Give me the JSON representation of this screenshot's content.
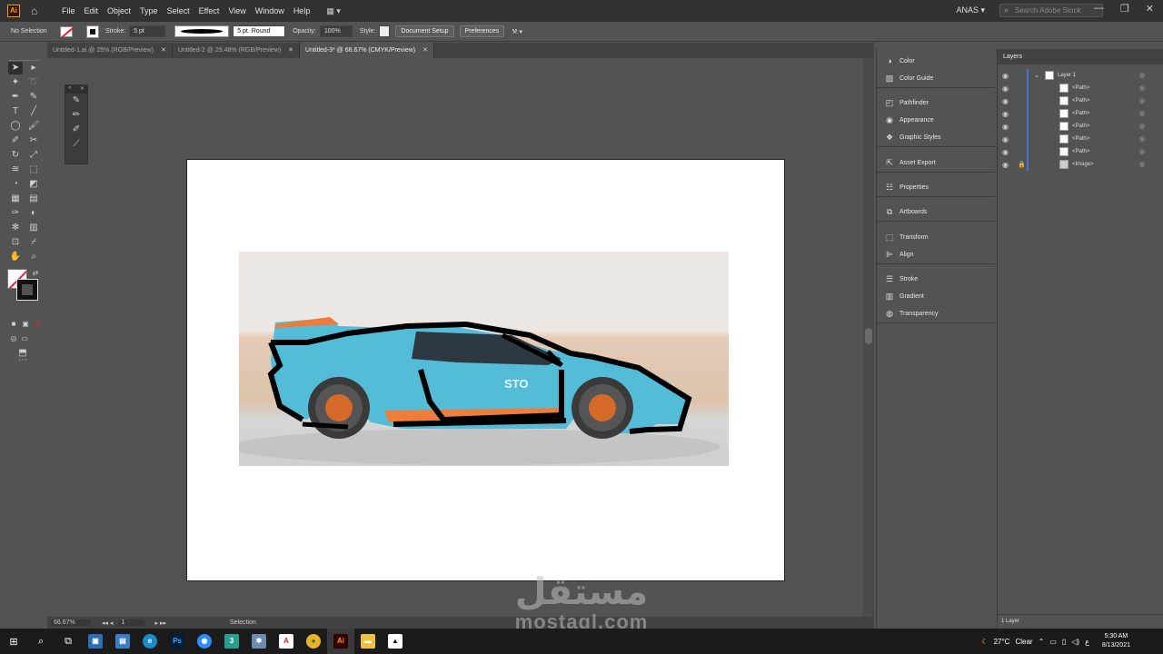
{
  "app": {
    "logo": "Ai",
    "user": "ANAS",
    "search_placeholder": "Search Adobe Stock"
  },
  "menu": [
    "File",
    "Edit",
    "Object",
    "Type",
    "Select",
    "Effect",
    "View",
    "Window",
    "Help"
  ],
  "control": {
    "selection": "No Selection",
    "stroke_label": "Stroke:",
    "stroke_value": "5 pt",
    "brush_label": "5 pt. Round",
    "opacity_label": "Opacity:",
    "opacity_value": "100%",
    "style_label": "Style:",
    "doc_setup": "Document Setup",
    "preferences": "Preferences"
  },
  "tabs": [
    {
      "label": "Untitled-1.ai @ 25% (RGB/Preview)"
    },
    {
      "label": "Untitled-2 @ 29.48% (RGB/Preview)"
    },
    {
      "label": "Untitled-3* @ 66.67% (CMYK/Preview)"
    }
  ],
  "status": {
    "zoom": "66.67%",
    "page": "1",
    "tool": "Selection"
  },
  "panels": [
    [
      "Color",
      "Color Guide"
    ],
    [
      "Pathfinder",
      "Appearance",
      "Graphic Styles"
    ],
    [
      "Asset Export"
    ],
    [
      "Properties"
    ],
    [
      "Artboards"
    ],
    [
      "Transform",
      "Align"
    ],
    [
      "Stroke",
      "Gradient",
      "Transparency"
    ]
  ],
  "layers": {
    "tab": "Layers",
    "rows": [
      "Layer 1",
      "<Path>",
      "<Path>",
      "<Path>",
      "<Path>",
      "<Path>",
      "<Path>",
      "<Image>"
    ],
    "footer": "1 Layer"
  },
  "car_badge": "STO",
  "watermark": {
    "arabic": "مستقل",
    "latin": "mostaql.com"
  },
  "taskbar": {
    "temp": "27°C",
    "weather": "Clear",
    "time": "5:30 AM",
    "date": "8/13/2021",
    "lang": "ع"
  }
}
